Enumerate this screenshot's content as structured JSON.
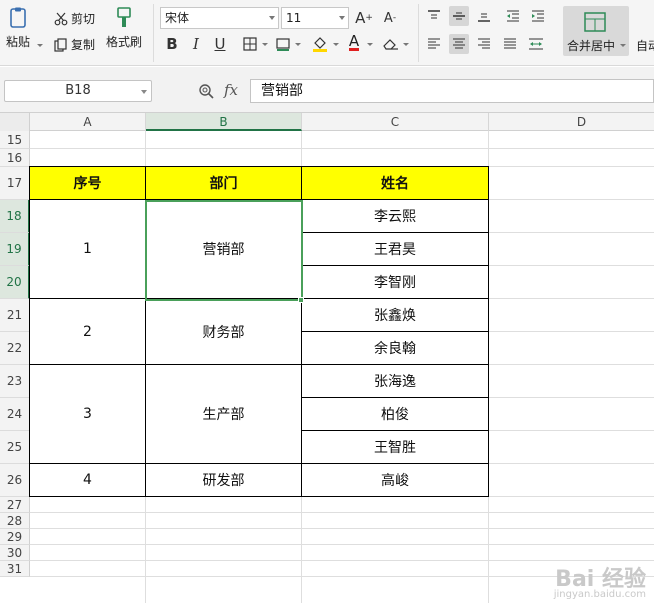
{
  "ribbon": {
    "paste_label": "粘贴",
    "cut_label": "剪切",
    "copy_label": "复制",
    "format_painter_label": "格式刷",
    "font_name": "宋体",
    "font_size": "11",
    "bold": "B",
    "italic": "I",
    "underline": "U",
    "font_color_glyph": "A",
    "merge_center_label": "合并居中",
    "auto_wrap_label": "自动"
  },
  "formula_bar": {
    "name_box": "B18",
    "fx": "fx",
    "formula": "营销部"
  },
  "grid": {
    "columns": [
      "A",
      "B",
      "C",
      "D"
    ],
    "rows": [
      "15",
      "16",
      "17",
      "18",
      "19",
      "20",
      "21",
      "22",
      "23",
      "24",
      "25",
      "26",
      "27",
      "28",
      "29",
      "30",
      "31"
    ],
    "selected_column": "B",
    "selected_rows": [
      "18",
      "19",
      "20"
    ]
  },
  "table": {
    "headers": [
      "序号",
      "部门",
      "姓名"
    ],
    "groups": [
      {
        "index": "1",
        "dept": "营销部",
        "names": [
          "李云熙",
          "王君昊",
          "李智刚"
        ]
      },
      {
        "index": "2",
        "dept": "财务部",
        "names": [
          "张鑫焕",
          "余良翰"
        ]
      },
      {
        "index": "3",
        "dept": "生产部",
        "names": [
          "张海逸",
          "柏俊",
          "王智胜"
        ]
      },
      {
        "index": "4",
        "dept": "研发部",
        "names": [
          "高峻"
        ]
      }
    ]
  },
  "colors": {
    "header_fill": "#ffff00",
    "selection": "#4aa05a",
    "accent": "#217346"
  },
  "watermark": {
    "brand": "Bai 经验",
    "url": "jingyan.baidu.com"
  }
}
